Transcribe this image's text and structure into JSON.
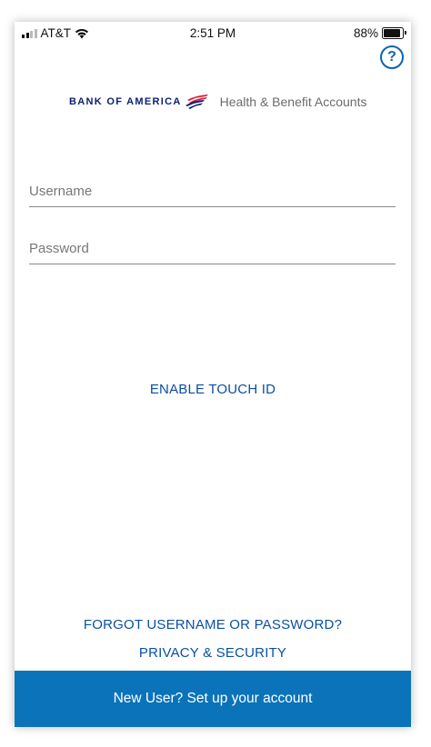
{
  "status_bar": {
    "carrier": "AT&T",
    "time": "2:51 PM",
    "battery_percent": "88%",
    "battery_level": 0.88,
    "signal_bars_active": 2,
    "signal_bars_total": 4
  },
  "header": {
    "help_symbol": "?",
    "help_icon": "question-circle-icon"
  },
  "brand": {
    "name": "BANK OF AMERICA",
    "product": "Health & Benefit Accounts",
    "colors": {
      "navy": "#0c2074",
      "red": "#e31837"
    }
  },
  "login": {
    "username_placeholder": "Username",
    "password_placeholder": "Password",
    "username_value": "",
    "password_value": ""
  },
  "links": {
    "touch_id": "ENABLE TOUCH ID",
    "forgot": "FORGOT USERNAME OR PASSWORD?",
    "privacy": "PRIVACY & SECURITY"
  },
  "footer": {
    "new_user_label": "New User? Set up your account"
  },
  "colors": {
    "accent": "#0b4fa3",
    "footer_bg": "#0a73b9"
  }
}
